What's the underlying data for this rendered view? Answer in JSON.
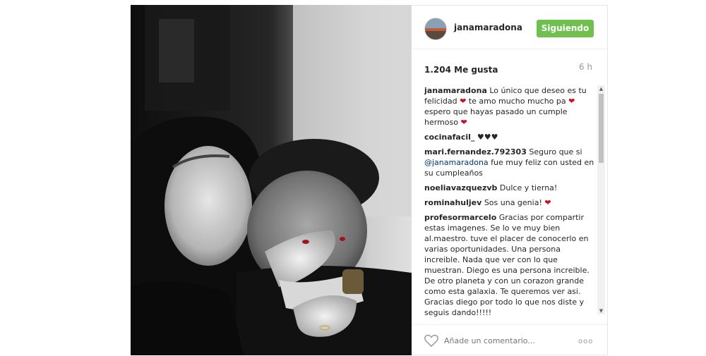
{
  "post": {
    "username": "janamaradona",
    "follow_label": "Siguiendo",
    "likes": "1.204 Me gusta",
    "time": "6 h"
  },
  "comments": [
    {
      "user": "janamaradona",
      "parts": [
        "Lo único que deseo es tu felicidad",
        " te amo mucho mucho pa",
        " espero que hayas pasado un cumple hermoso",
        ""
      ]
    },
    {
      "user": "cocinafacil_",
      "text": "♥♥♥"
    },
    {
      "user": "mari.fernandez.792303",
      "pre": "Seguro que si",
      "mention": "@janamaradona",
      "post": "fue muy feliz con usted en su cumpleaños"
    },
    {
      "user": "noeliavazquezvb",
      "text": "Dulce y tierna!"
    },
    {
      "user": "rominahuljev",
      "text": "Sos una genia!"
    },
    {
      "user": "profesormarcelo",
      "text": "Gracias por compartir estas imagenes. Se lo ve muy bien al.maestro. tuve el placer de conocerlo en varias oportunidades. Una persona increible. Nada que ver con lo que muestran. Diego es una persona increible. De otro planeta y con un corazon grande como esta galaxia. Te queremos ver asi. Gracias diego por todo lo que nos diste y seguis dando!!!!!"
    }
  ],
  "footer": {
    "comment_placeholder": "Añade un comentario...",
    "more_label": "ooo"
  },
  "icons": {
    "heart": "heart-icon",
    "more": "more-options-icon"
  },
  "colors": {
    "follow_button": "#70c050",
    "mention": "#003569",
    "heart_red": "#c8101e"
  }
}
